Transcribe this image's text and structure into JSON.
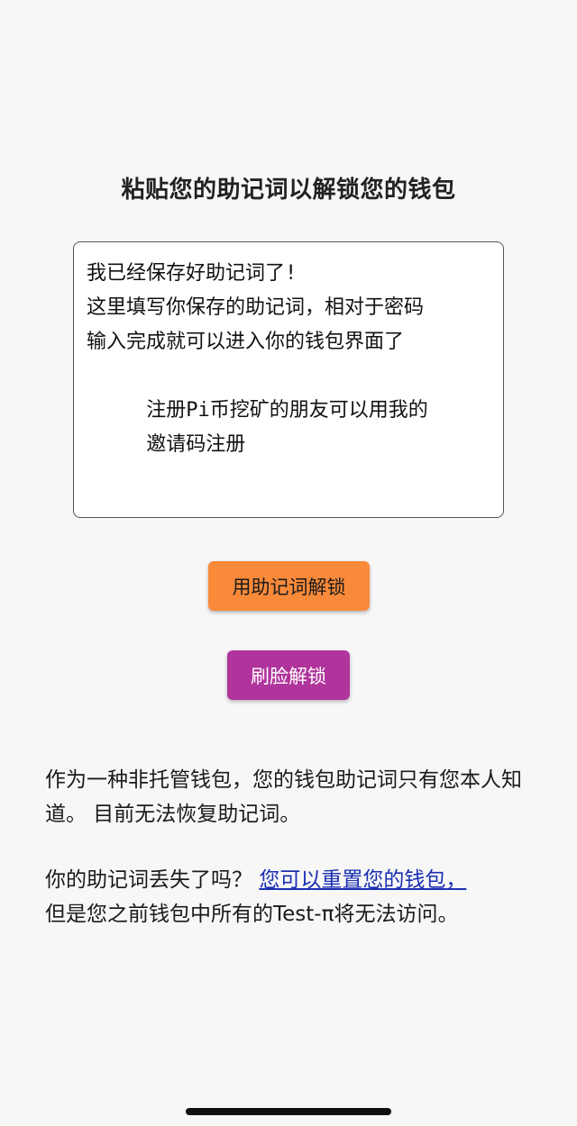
{
  "page": {
    "title": "粘贴您的助记词以解锁您的钱包"
  },
  "mnemonic_input": {
    "value": "我已经保存好助记词了!\n这里填写你保存的助记词，相对于密码\n输入完成就可以进入你的钱包界面了\n\n     注册Pi币挖矿的朋友可以用我的\n     邀请码注册"
  },
  "buttons": {
    "unlock_mnemonic": "用助记词解锁",
    "unlock_face": "刷脸解锁"
  },
  "info": {
    "custody_text": "作为一种非托管钱包，您的钱包助记词只有您本人知道。 目前无法恢复助记词。",
    "lost_question": "你的助记词丢失了吗？ ",
    "reset_link": "您可以重置您的钱包，",
    "warning_text": "但是您之前钱包中所有的Test-π将无法访问。"
  },
  "colors": {
    "background": "#f7f7f8",
    "unlock_mnemonic_button": "#f98a39",
    "unlock_face_button": "#b0349c",
    "link": "#1a2fb0"
  }
}
